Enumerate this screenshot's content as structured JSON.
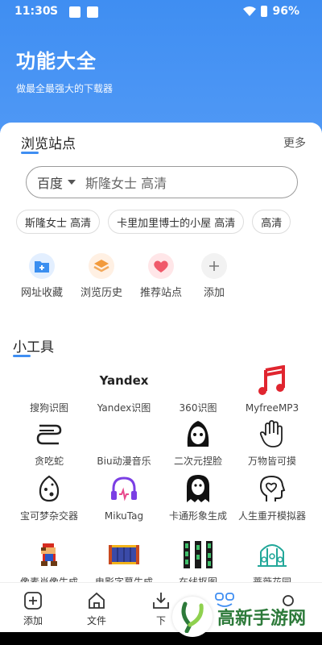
{
  "status_bar": {
    "time": "11:30",
    "sim_letter": "S",
    "battery": "96%"
  },
  "header": {
    "title": "功能大全",
    "subtitle": "做最全最强大的下载器"
  },
  "browse": {
    "title": "浏览站点",
    "more": "更多",
    "search": {
      "engine": "百度",
      "query": "斯隆女士 高清"
    },
    "chips": [
      "斯隆女士 高清",
      "卡里加里博士的小屋 高清",
      "高清"
    ],
    "quick": [
      {
        "label": "网址收藏",
        "icon": "folder-plus-icon"
      },
      {
        "label": "浏览历史",
        "icon": "layers-icon"
      },
      {
        "label": "推荐站点",
        "icon": "hearts-icon"
      },
      {
        "label": "添加",
        "icon": "plus-icon"
      }
    ]
  },
  "tools": {
    "title": "小工具",
    "items": [
      {
        "label": "搜狗识图",
        "icon": "sogou-icon"
      },
      {
        "label": "Yandex识图",
        "icon": "yandex-logo",
        "icon_text": "Yandex"
      },
      {
        "label": "360识图",
        "icon": "360-icon"
      },
      {
        "label": "MyfreeMP3",
        "icon": "music-note-icon"
      },
      {
        "label": "贪吃蛇",
        "icon": "snake-icon"
      },
      {
        "label": "Biu动漫音乐",
        "icon": "biu-icon"
      },
      {
        "label": "二次元捏脸",
        "icon": "anime-face-icon"
      },
      {
        "label": "万物皆可摸",
        "icon": "hand-icon"
      },
      {
        "label": "宝可梦杂交器",
        "icon": "egg-icon"
      },
      {
        "label": "MikuTag",
        "icon": "headphones-icon"
      },
      {
        "label": "卡通形象生成",
        "icon": "ghost-icon"
      },
      {
        "label": "人生重开模拟器",
        "icon": "head-heart-icon"
      },
      {
        "label": "像素肖像生成",
        "icon": "pixel-mario-icon"
      },
      {
        "label": "电影字幕生成",
        "icon": "film-strip-icon"
      },
      {
        "label": "在线抠图",
        "icon": "film-frames-icon"
      },
      {
        "label": "蔷薇花园",
        "icon": "garden-icon"
      }
    ]
  },
  "bottom_nav": [
    {
      "label": "添加",
      "icon": "add-box-icon"
    },
    {
      "label": "文件",
      "icon": "home-icon"
    },
    {
      "label": "下",
      "icon": "download-icon"
    },
    {
      "label": "",
      "icon": "function-icon"
    },
    {
      "label": "",
      "icon": "circle-icon"
    }
  ],
  "watermark": {
    "text": "高新手游网"
  },
  "colors": {
    "primary": "#3f8ef2",
    "music_red": "#e0252f",
    "miku_purple": "#7b3fe4",
    "garden_teal": "#24a89a"
  }
}
